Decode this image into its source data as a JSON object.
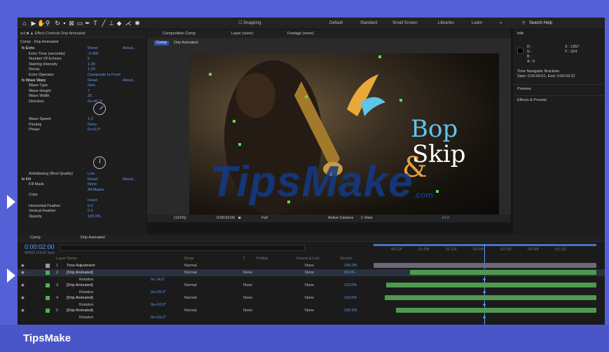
{
  "watermark": "TipsMake",
  "toolbar": {
    "snapping": "Snapping",
    "workspaces": [
      "Default",
      "Standard",
      "Small Screen",
      "Libraries",
      "Learn"
    ],
    "search_placeholder": "Search Help"
  },
  "effect_panel": {
    "header": "Effect Controls Drip Animated",
    "subtitle": "Comp · Drip Animated",
    "rows": [
      {
        "label": "fx Echo",
        "value": "Reset",
        "extra": "About..."
      },
      {
        "label": "Echo Time (seconds)",
        "value": "-0.400"
      },
      {
        "label": "Number Of Echoes",
        "value": "5"
      },
      {
        "label": "Starting Intensity",
        "value": "1.00"
      },
      {
        "label": "Decay",
        "value": "1.00"
      },
      {
        "label": "Echo Operator",
        "value": "Composite In Front"
      },
      {
        "label": "fx Wave Warp",
        "value": "Reset",
        "extra": "About..."
      },
      {
        "label": "Wave Type",
        "value": "Sine"
      },
      {
        "label": "Wave Height",
        "value": "7"
      },
      {
        "label": "Wave Width",
        "value": "30"
      },
      {
        "label": "Direction",
        "value": "0x+45.0°"
      }
    ],
    "rows2": [
      {
        "label": "Wave Speed",
        "value": "1.0"
      },
      {
        "label": "Pinning",
        "value": "None"
      },
      {
        "label": "Phase",
        "value": "0x+0.0°"
      }
    ],
    "rows3": [
      {
        "label": "Antialiasing (Best Quality)",
        "value": "Low"
      },
      {
        "label": "fx Fill",
        "value": "Reset",
        "extra": "About..."
      },
      {
        "label": "Fill Mask",
        "value": "None"
      },
      {
        "label": "",
        "value": "All Masks"
      },
      {
        "label": "Color",
        "value": ""
      },
      {
        "label": "",
        "value": "Invert"
      },
      {
        "label": "Horizontal Feather",
        "value": "0.0"
      },
      {
        "label": "Vertical Feather",
        "value": "0.0"
      },
      {
        "label": "Opacity",
        "value": "100.0%"
      }
    ]
  },
  "viewer": {
    "tabs": [
      "Composition Comp",
      "Layer (none)",
      "Footage (none)"
    ],
    "breadcrumb": [
      "Comp",
      "Drip Animated"
    ],
    "art_words": {
      "w1": "Bop",
      "w2": "Skip",
      "amp": "&"
    },
    "overlay": "TipsMake",
    "overlay_sub": ".com",
    "bottom": {
      "zoom": "(121%)",
      "time": "0:00:02:00",
      "res": "Full",
      "camera": "Active Camera",
      "view": "1 View",
      "exposure": "+0.0"
    }
  },
  "right_panel": {
    "info_title": "Info",
    "x": "X : 1357",
    "y": "Y : 324",
    "rgb": [
      "R :",
      "G :",
      "B :",
      "A : 0"
    ],
    "nav": "Time Navigator Brackets",
    "nav2": "Start: 0:00:00:01, End: 0:00:03:22",
    "preview": "Preview",
    "effects": "Effects & Presets"
  },
  "timeline": {
    "tab": "Comp",
    "tab2": "Drip Animated",
    "timecode": "0:00:02:00",
    "fps": "00060 (29.97 fps)",
    "cols": [
      "Layer Name",
      "Mode",
      "T",
      "TrkMat",
      "Parent & Link",
      "Stretch"
    ],
    "rulers": [
      "00:12f",
      "01:00f",
      "01:12f",
      "02:00f",
      "02:12f",
      "03:00f",
      "03:12f"
    ],
    "layers": [
      {
        "num": "1",
        "name": "Tone Adjustment",
        "mode": "Normal",
        "trk": "",
        "parent": "None",
        "stretch": "100.0%"
      },
      {
        "num": "2",
        "name": "[Drip Animated]",
        "mode": "Normal",
        "trk": "None",
        "parent": "None",
        "stretch": "90.0%"
      },
      {
        "num": "3",
        "name": "[Drip Animated]",
        "mode": "Normal",
        "trk": "None",
        "parent": "None",
        "stretch": "110.0%"
      },
      {
        "num": "4",
        "name": "[Drip Animated]",
        "mode": "Normal",
        "trk": "None",
        "parent": "None",
        "stretch": "110.0%"
      },
      {
        "num": "5",
        "name": "[Drip Animated]",
        "mode": "Normal",
        "trk": "None",
        "parent": "None",
        "stretch": "100.0%"
      }
    ],
    "sub": [
      {
        "label": "Rotation",
        "value": "0x-14.0°"
      },
      {
        "label": "Rotation",
        "value": "0x+20.0°"
      },
      {
        "label": "Rotation",
        "value": "0x+10.0°"
      },
      {
        "label": "Rotation",
        "value": "0x+15.0°"
      }
    ]
  }
}
